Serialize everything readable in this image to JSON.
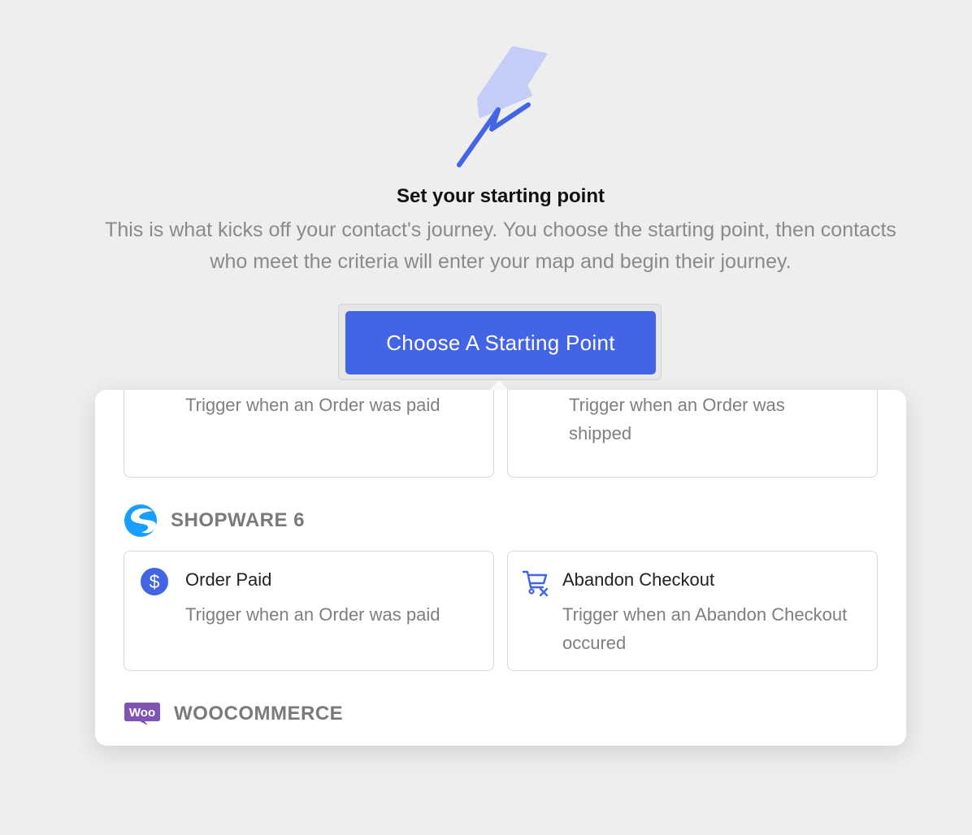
{
  "header": {
    "title": "Set your starting point",
    "subtitle": "This is what kicks off your contact's journey. You choose the starting point, then contacts who meet the criteria will enter your map and begin their journey.",
    "cta_label": "Choose A Starting Point"
  },
  "dropdown": {
    "top_cards": [
      {
        "description": "Trigger when an Order was paid"
      },
      {
        "description": "Trigger when an Order was shipped"
      }
    ],
    "sections": [
      {
        "label": "SHOPWARE 6",
        "icon": "shopware-logo-icon",
        "cards": [
          {
            "icon": "dollar-icon",
            "title": "Order Paid",
            "description": "Trigger when an Order was paid"
          },
          {
            "icon": "cart-remove-icon",
            "title": "Abandon Checkout",
            "description": "Trigger when an Abandon Checkout occured"
          }
        ]
      },
      {
        "label": "WOOCOMMERCE",
        "icon": "woocommerce-logo-icon",
        "logo_text": "Woo"
      }
    ]
  },
  "colors": {
    "accent": "#4464e6",
    "background": "#eeeeee",
    "woo_purple": "#7f54b3",
    "shopware_blue": "#189eff"
  }
}
